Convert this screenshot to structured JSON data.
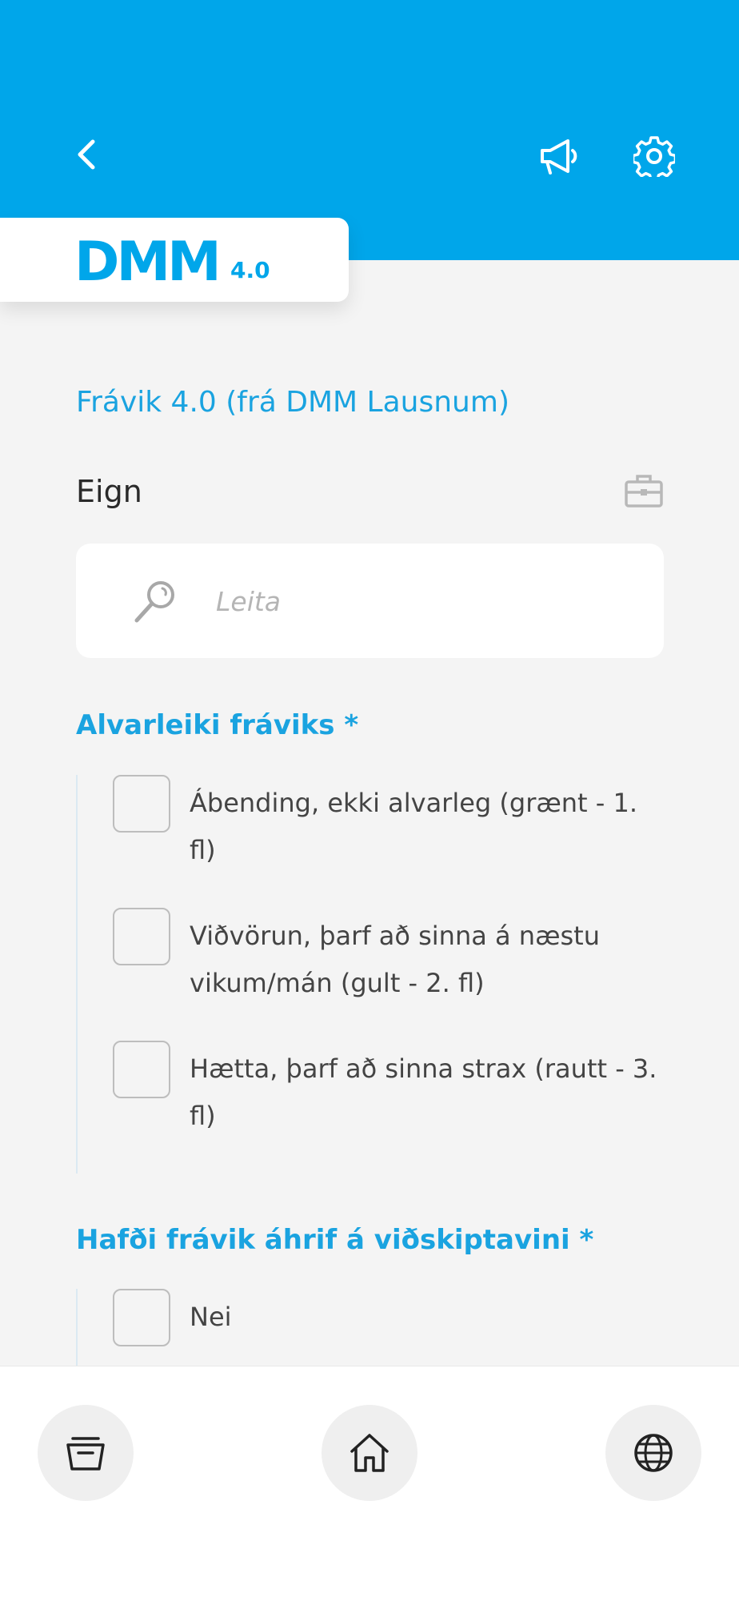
{
  "header": {
    "back_icon": "chevron-left-icon",
    "announce_icon": "megaphone-icon",
    "settings_icon": "gear-icon",
    "background": "#00a6ea"
  },
  "logo": {
    "main": "DMM",
    "version": "4.0"
  },
  "form": {
    "title": "Frávik 4.0 (frá DMM Lausnum)",
    "asset_label": "Eign",
    "search_placeholder": "Leita"
  },
  "severity": {
    "title": "Alvarleiki fráviks *",
    "options": [
      {
        "label": "Ábending, ekki alvarleg (grænt - 1. fl)",
        "checked": false
      },
      {
        "label": "Viðvörun, þarf að sinna á næstu vikum/mán (gult - 2. fl)",
        "checked": false
      },
      {
        "label": "Hætta, þarf að sinna strax (rautt - 3. fl)",
        "checked": false
      }
    ]
  },
  "customer_impact": {
    "title": "Hafði frávik áhrif á viðskiptavini *",
    "options": [
      {
        "label": "Nei",
        "checked": false
      }
    ]
  },
  "bottom_nav": {
    "items": [
      "archive-icon",
      "home-icon",
      "globe-icon"
    ]
  },
  "colors": {
    "accent": "#1aa3e0",
    "brand": "#00a6ea"
  }
}
